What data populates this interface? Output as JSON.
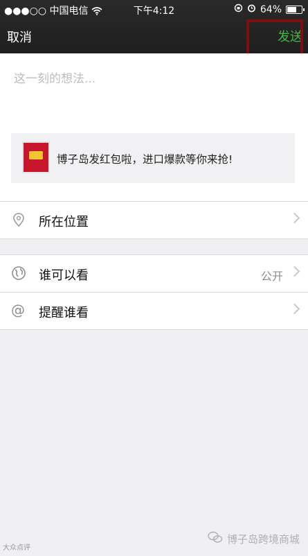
{
  "statusbar": {
    "signal": "●●●○○",
    "carrier": "中国电信",
    "time": "下午4:12",
    "battery": "64%"
  },
  "navbar": {
    "cancel": "取消",
    "send": "发送"
  },
  "compose": {
    "placeholder": "这一刻的想法..."
  },
  "link_card": {
    "text": "博子岛发红包啦，进口爆款等你来抢!"
  },
  "rows": {
    "location": {
      "label": "所在位置",
      "icon": "location-pin-icon"
    },
    "visibility": {
      "label": "谁可以看",
      "value": "公开",
      "icon": "globe-icon"
    },
    "mention": {
      "label": "提醒谁看",
      "icon": "at-icon"
    }
  },
  "watermark": {
    "left": "大众点评",
    "right": "博子岛跨境商城"
  },
  "colors": {
    "send_green": "#3dbb3c",
    "highlight_red": "#7c1010",
    "topbar": "#222222",
    "background": "#efeff4"
  }
}
